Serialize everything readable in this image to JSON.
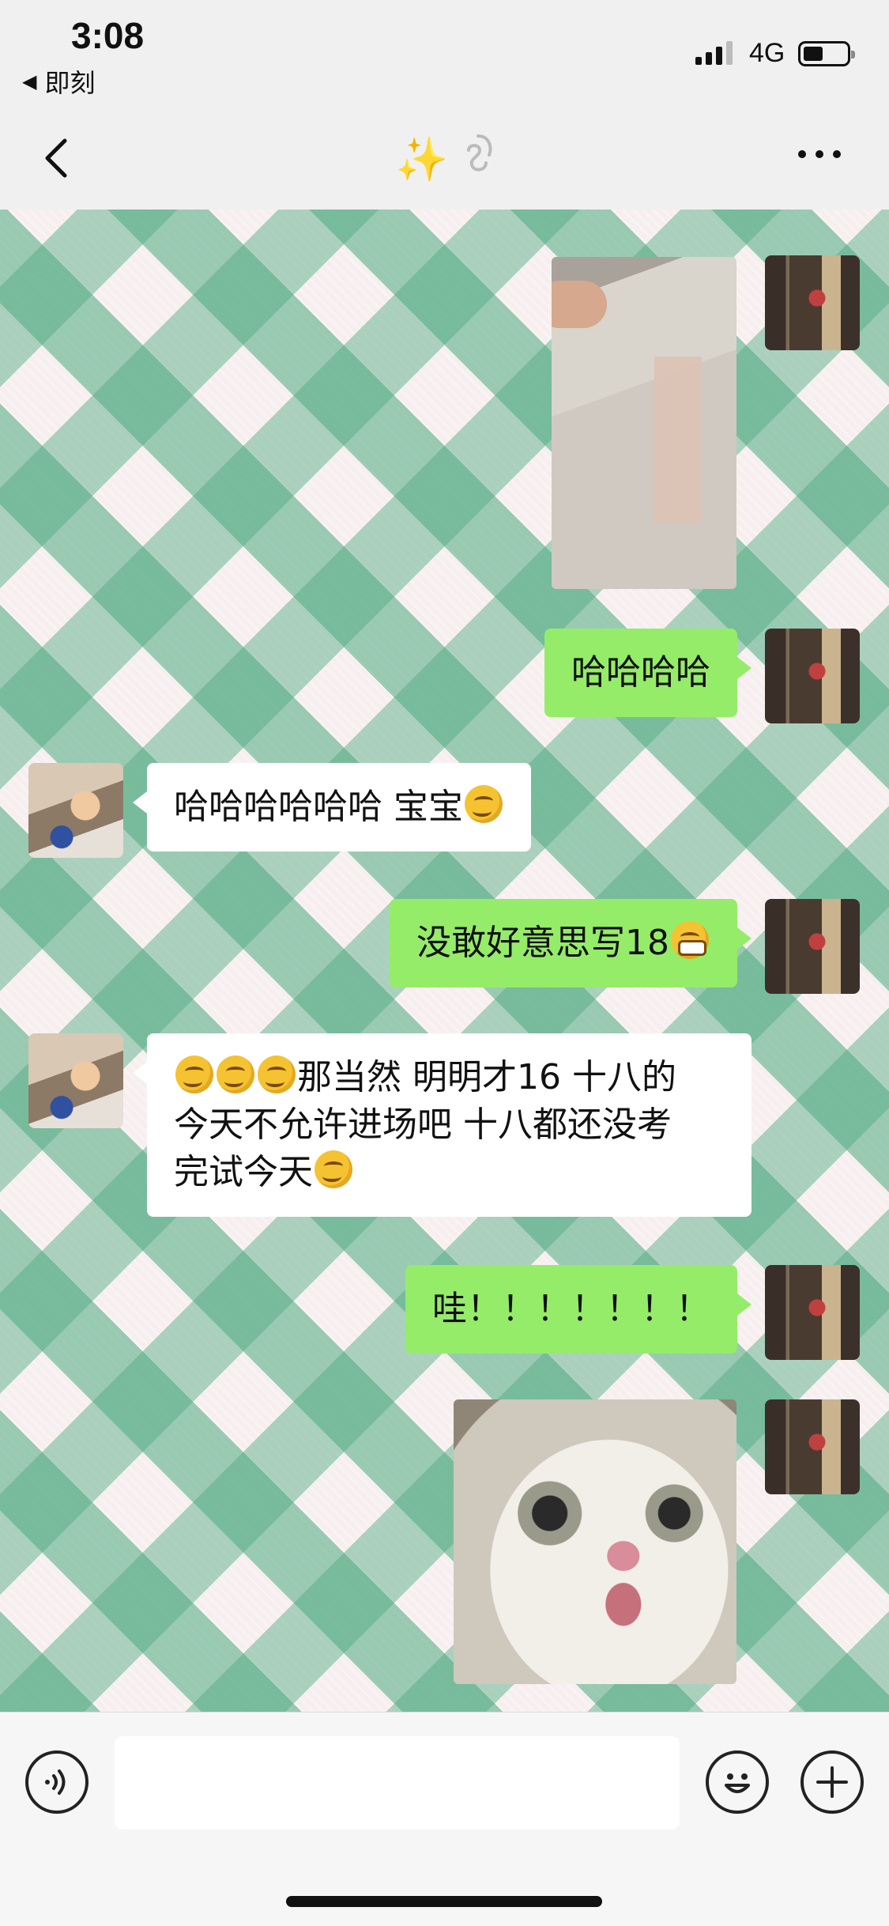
{
  "status_bar": {
    "time": "3:08",
    "back_app_label": "即刻",
    "network": "4G"
  },
  "nav": {
    "title": "✨",
    "title_icon": "ear-icon",
    "back_icon": "chevron-left-icon",
    "more_icon": "more-dots-icon"
  },
  "messages": [
    {
      "side": "me",
      "type": "image",
      "content": "document-photo"
    },
    {
      "side": "me",
      "type": "text",
      "text": "哈哈哈哈"
    },
    {
      "side": "them",
      "type": "text",
      "text": "哈哈哈哈哈哈 宝宝",
      "emoji": "hmm-emoji"
    },
    {
      "side": "me",
      "type": "text",
      "text": "没敢好意思写18",
      "emoji": "grin-emoji"
    },
    {
      "side": "them",
      "type": "text",
      "line1": "那当然 明明才16 十八的",
      "line2": "今天不允许进场吧 十八都还没考",
      "line3": "完试今天",
      "emoji": "hmm-emoji"
    },
    {
      "side": "me",
      "type": "text",
      "text": "哇！！！！！！！"
    },
    {
      "side": "me",
      "type": "image",
      "content": "cat-photo"
    }
  ],
  "input_bar": {
    "voice_icon": "voice-icon",
    "input_value": "",
    "emoji_icon": "smiley-icon",
    "plus_icon": "plus-icon"
  },
  "colors": {
    "my_bubble": "#95ec69",
    "their_bubble": "#ffffff",
    "bar_bg": "#f0f0f0"
  }
}
